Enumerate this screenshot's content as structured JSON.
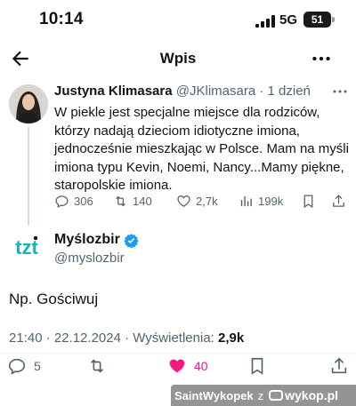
{
  "status_bar": {
    "time": "10:14",
    "network": "5G",
    "battery": "51"
  },
  "header": {
    "title": "Wpis"
  },
  "parent_tweet": {
    "name": "Justyna Klimasara",
    "handle": "@JKlimasara",
    "separator": "·",
    "time": "1 dzień",
    "text": "W piekle jest specjalne miejsce dla rodziców, którzy nadają dzieciom idiotyczne imiona, jednocześnie mieszkając w Polsce. Mam na myśli imiona typu Kevin, Noemi, Nancy...Mamy piękne, staropolskie imiona.",
    "replies": "306",
    "retweets": "140",
    "likes": "2,7k",
    "views": "199k"
  },
  "main_tweet": {
    "name": "Myślozbir",
    "handle": "@myslozbir",
    "text": "Np. Gościwuj",
    "meta_prefix": "21:40 · 22.12.2024 · Wyświetlenia: ",
    "views": "2,9k",
    "replies": "5",
    "likes": "40"
  },
  "watermark": {
    "user": "SaintWykopek",
    "connector": "z",
    "site": "wykop.pl"
  },
  "colors": {
    "accent_blue": "#1d9bf0",
    "like_pink": "#f91880",
    "muted": "#536471",
    "logo_teal": "#12b3c2"
  }
}
